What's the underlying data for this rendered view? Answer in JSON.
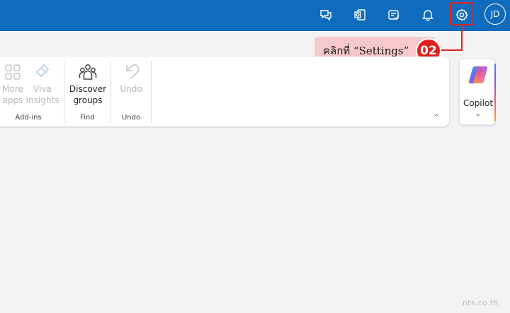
{
  "topbar": {
    "icons": [
      "feedback-icon",
      "outlook-icon",
      "tasks-icon",
      "notifications-icon",
      "settings-icon"
    ],
    "avatar_initials": "JD",
    "color": "#0f6cbd"
  },
  "callout": {
    "text": "คลิกที่ “Settings”",
    "step": "02",
    "color": "#e02020"
  },
  "ribbon": {
    "addins": {
      "more_apps_line1": "More",
      "more_apps_line2": "apps",
      "viva_line1": "Viva",
      "viva_line2": "Insights",
      "label": "Add-ins"
    },
    "find": {
      "discover_line1": "Discover",
      "discover_line2": "groups",
      "label": "Find"
    },
    "undo": {
      "button": "Undo",
      "label": "Undo"
    },
    "collapse_glyph": "^"
  },
  "copilot": {
    "label": "Copilot",
    "chevron": "⌄"
  },
  "watermark": "nts.co.th"
}
